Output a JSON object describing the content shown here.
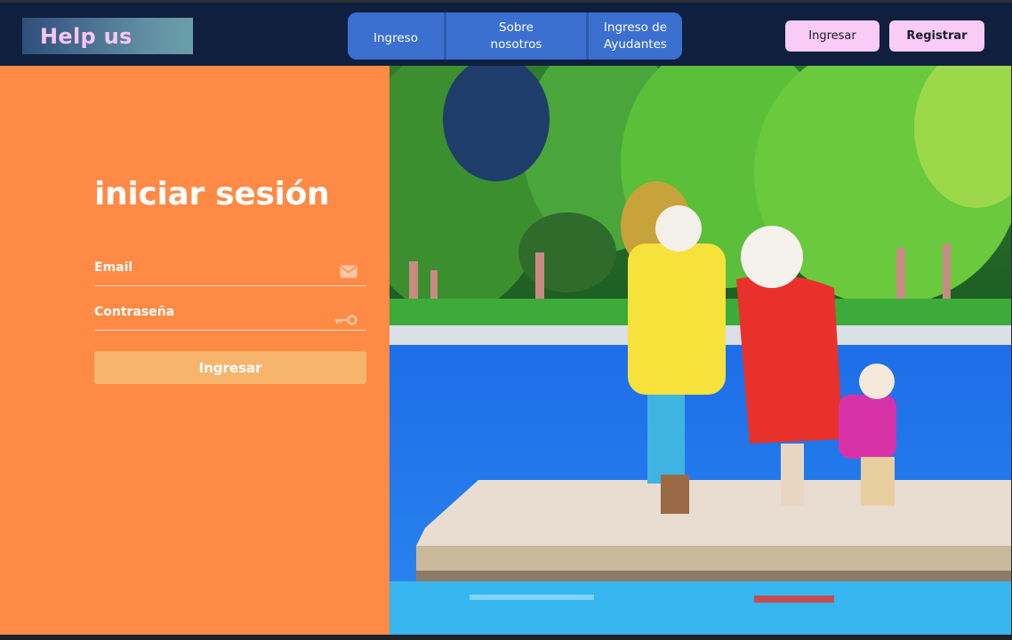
{
  "header": {
    "logo_text": "Help us",
    "nav_tabs": [
      {
        "label": "Ingreso"
      },
      {
        "label": "Sobre nosotros"
      },
      {
        "label": "Ingreso de Ayudantes"
      }
    ],
    "login_button": "Ingresar",
    "register_button": "Registrar"
  },
  "login": {
    "title": "iniciar sesión",
    "email_label": "Email",
    "password_label": "Contraseña",
    "submit_label": "Ingresar"
  },
  "icons": {
    "email": "envelope-icon",
    "password": "key-icon"
  },
  "colors": {
    "topbar": "#0f1f3d",
    "nav_bg": "#3b6fd0",
    "panel": "#ff8a45",
    "button_pink": "#f8ccf6",
    "submit": "#f7b46d"
  }
}
